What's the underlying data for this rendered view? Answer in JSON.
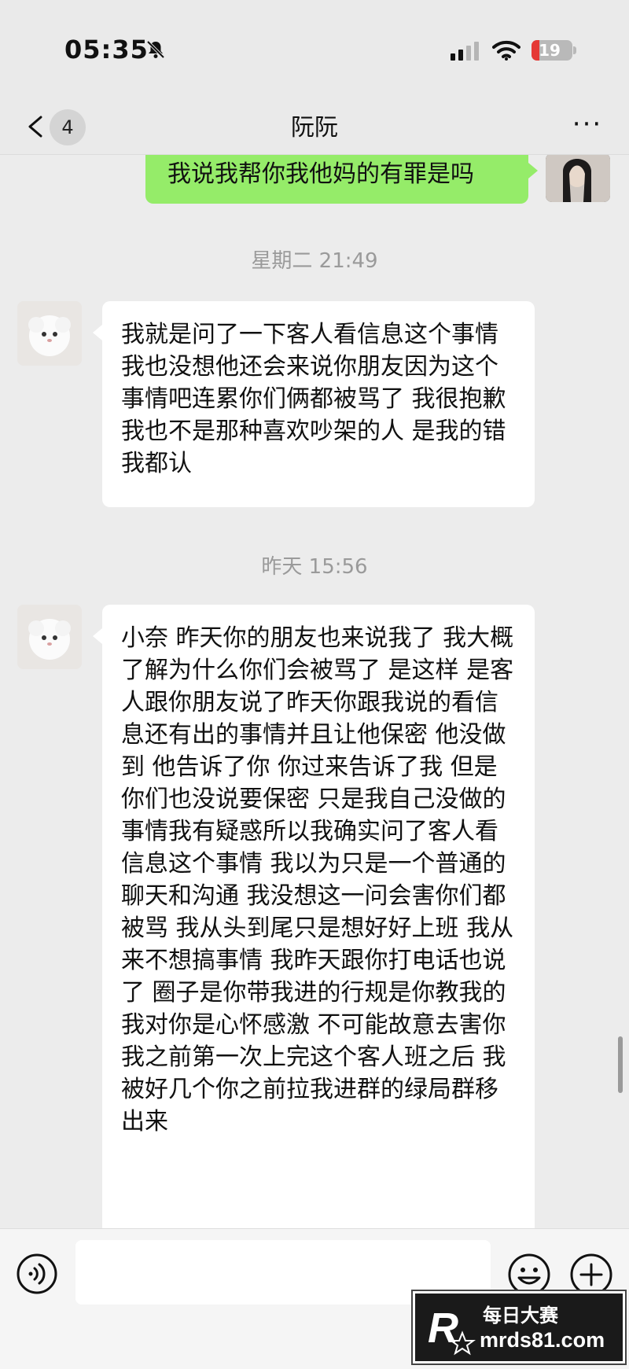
{
  "status_bar": {
    "time": "05:35",
    "battery_level": "19",
    "battery_fraction": 0.19
  },
  "header": {
    "back_count": "4",
    "title": "阮阮",
    "more_label": "···"
  },
  "messages": [
    {
      "type": "outgoing",
      "text": "我说我帮你我他妈的有罪是吗"
    },
    {
      "type": "timestamp",
      "text": "星期二 21:49"
    },
    {
      "type": "incoming",
      "text": " 我就是问了一下客人看信息这个事情  我也没想他还会来说你朋友因为这个事情吧连累你们俩都被骂了 我很抱歉 我也不是那种喜欢吵架的人 是我的错我都认"
    },
    {
      "type": "timestamp",
      "text": "昨天 15:56"
    },
    {
      "type": "incoming",
      "text": "小奈 昨天你的朋友也来说我了 我大概了解为什么你们会被骂了 是这样 是客人跟你朋友说了昨天你跟我说的看信息还有出的事情并且让他保密 他没做到 他告诉了你 你过来告诉了我 但是你们也没说要保密 只是我自己没做的事情我有疑惑所以我确实问了客人看信息这个事情 我以为只是一个普通的聊天和沟通 我没想这一问会害你们都被骂 我从头到尾只是想好好上班 我从来不想搞事情 我昨天跟你打电话也说了 圈子是你带我进的行规是你教我的 我对你是心怀感激 不可能故意去害你 我之前第一次上完这个客人班之后 我被好几个你之前拉我进群的绿局群移出来"
    }
  ],
  "icons": {
    "back": "chevron-left-icon",
    "bell": "bell-slash-icon",
    "voice": "voice-icon",
    "emoji": "smile-icon",
    "plus": "plus-icon"
  },
  "watermark": {
    "title": "每日大赛",
    "site": "mrds81.com"
  },
  "colors": {
    "outgoing_bubble": "#95ec69",
    "incoming_bubble": "#ffffff",
    "background": "#ececec",
    "battery_low": "#e53935"
  }
}
